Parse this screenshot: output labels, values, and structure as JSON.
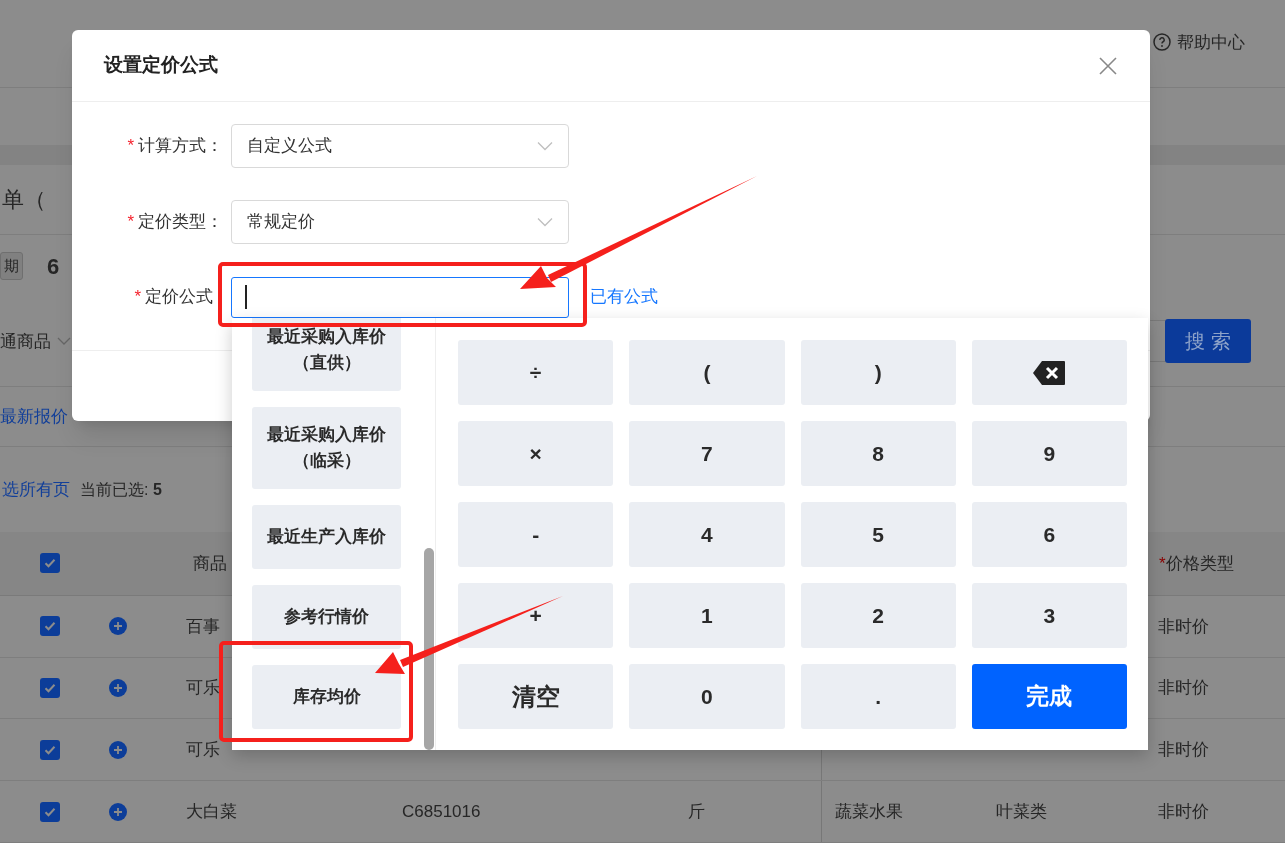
{
  "page": {
    "help": "帮助中心",
    "title": "单（",
    "period_tag": "期",
    "period": "6",
    "filter": {
      "value": "通商品"
    },
    "search_button": "搜 索",
    "latest_price_link": "最新报价",
    "select_all_link": "选所有页",
    "selected_count": "当前已选: **5**",
    "table": {
      "header_checked": true,
      "columns": [
        {
          "label": "商品"
        },
        {
          "label": "价格类型",
          "required_mark": "*"
        }
      ],
      "rows": [
        {
          "checked": true,
          "name": "百事",
          "price_type": "非时价"
        },
        {
          "checked": true,
          "name": "可乐",
          "price_type": "非时价"
        },
        {
          "checked": true,
          "name": "可乐",
          "price_type": "非时价"
        },
        {
          "checked": true,
          "name": "大白菜",
          "code": "C6851016",
          "unit": "斤",
          "category": "蔬菜水果",
          "subcategory": "叶菜类",
          "price_type": "非时价"
        }
      ]
    }
  },
  "modal": {
    "title": "设置定价公式",
    "fields": [
      {
        "label": "计算方式：",
        "required_mark": "*",
        "kind": "select",
        "value": "自定义公式"
      },
      {
        "label": "定价类型：",
        "required_mark": "*",
        "kind": "select",
        "value": "常规定价"
      },
      {
        "label": "定价公式",
        "required_mark": "*",
        "kind": "input",
        "focused": true,
        "link": "已有公式"
      }
    ]
  },
  "keypad": {
    "variables": [
      {
        "label": "最近采购入库价（直供）"
      },
      {
        "label": "最近采购入库价（临采）"
      },
      {
        "label": "最近生产入库价"
      },
      {
        "label": "参考行情价"
      },
      {
        "label": "库存均价"
      }
    ],
    "keys": [
      {
        "kind": "key",
        "label": "÷"
      },
      {
        "kind": "key",
        "label": "("
      },
      {
        "kind": "key",
        "label": ")"
      },
      {
        "kind": "backspace"
      },
      {
        "kind": "key",
        "label": "×"
      },
      {
        "kind": "key",
        "label": "7"
      },
      {
        "kind": "key",
        "label": "8"
      },
      {
        "kind": "key",
        "label": "9"
      },
      {
        "kind": "key",
        "label": "-"
      },
      {
        "kind": "key",
        "label": "4"
      },
      {
        "kind": "key",
        "label": "5"
      },
      {
        "kind": "key",
        "label": "6"
      },
      {
        "kind": "key",
        "label": "+"
      },
      {
        "kind": "key",
        "label": "1"
      },
      {
        "kind": "key",
        "label": "2"
      },
      {
        "kind": "key",
        "label": "3"
      },
      {
        "kind": "clear",
        "label": "清空"
      },
      {
        "kind": "key",
        "label": "0"
      },
      {
        "kind": "key",
        "label": "."
      },
      {
        "kind": "done",
        "label": "完成"
      }
    ]
  }
}
